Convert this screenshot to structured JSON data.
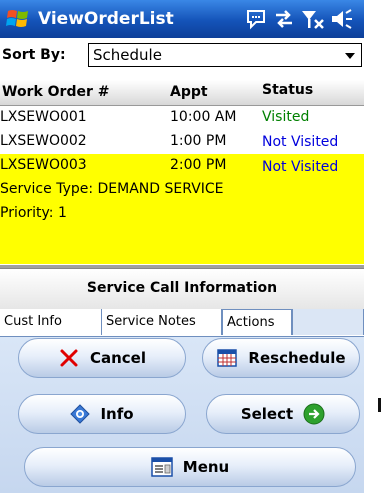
{
  "titlebar": {
    "title": "ViewOrderList",
    "icons": [
      "windows-logo-icon",
      "message-icon",
      "connectivity-icon",
      "signal-off-icon",
      "volume-icon"
    ]
  },
  "sort": {
    "label": "Sort By:",
    "value": "Schedule"
  },
  "grid": {
    "columns": [
      "Work Order #",
      "Appt",
      "Status"
    ],
    "rows": [
      {
        "order": "LXSEWO001",
        "appt": "10:00 AM",
        "status": "Visited"
      },
      {
        "order": "LXSEWO002",
        "appt": "1:00 PM",
        "status": "Not Visited"
      },
      {
        "order": "LXSEWO003",
        "appt": "2:00 PM",
        "status": "Not Visited"
      }
    ],
    "selected_details": {
      "service_type": "Service Type:  DEMAND SERVICE",
      "priority": "Priority:  1"
    }
  },
  "service_call": {
    "header": "Service Call Information",
    "tabs": [
      "Cust Info",
      "Service Notes",
      "Actions"
    ],
    "active_tab": "Actions"
  },
  "buttons": {
    "cancel": "Cancel",
    "reschedule": "Reschedule",
    "info": "Info",
    "select": "Select",
    "menu": "Menu"
  },
  "colors": {
    "titlebar": "#1453b8",
    "selected_row": "#ffff00",
    "visited": "#008000",
    "not_visited": "#0000dd"
  }
}
